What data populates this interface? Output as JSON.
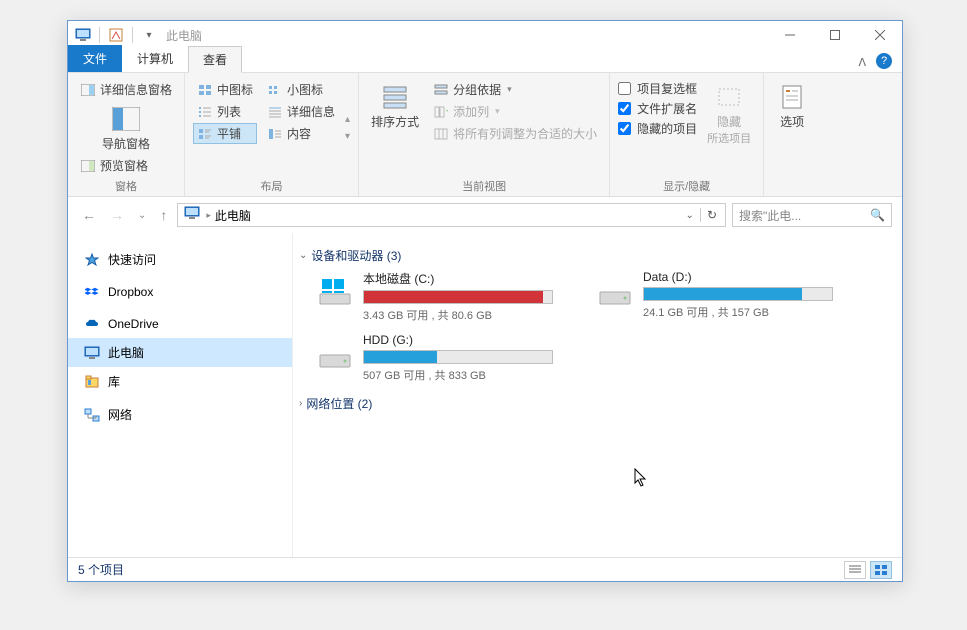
{
  "window": {
    "title": "此电脑"
  },
  "tabs": {
    "file": "文件",
    "computer": "计算机",
    "view": "查看"
  },
  "ribbon": {
    "panes": {
      "nav_pane": "导航窗格",
      "preview_pane": "预览窗格",
      "details_pane": "详细信息窗格",
      "group_label": "窗格"
    },
    "layout": {
      "medium_icons": "中图标",
      "small_icons": "小图标",
      "list": "列表",
      "details": "详细信息",
      "tiles": "平铺",
      "content": "内容",
      "group_label": "布局"
    },
    "current_view": {
      "sort_by": "排序方式",
      "group_by": "分组依据",
      "add_columns": "添加列",
      "size_all": "将所有列调整为合适的大小",
      "group_label": "当前视图"
    },
    "show_hide": {
      "item_check": "项目复选框",
      "file_ext": "文件扩展名",
      "hidden_items": "隐藏的项目",
      "hide": "隐藏",
      "hide_sub": "所选项目",
      "group_label": "显示/隐藏"
    },
    "options": {
      "label": "选项"
    }
  },
  "address": {
    "crumb": "此电脑"
  },
  "search": {
    "placeholder": "搜索\"此电..."
  },
  "sidebar": {
    "items": [
      {
        "label": "快速访问",
        "icon": "star"
      },
      {
        "label": "Dropbox",
        "icon": "dropbox"
      },
      {
        "label": "OneDrive",
        "icon": "onedrive"
      },
      {
        "label": "此电脑",
        "icon": "pc",
        "selected": true
      },
      {
        "label": "库",
        "icon": "libraries"
      },
      {
        "label": "网络",
        "icon": "network"
      }
    ]
  },
  "content": {
    "devices_header": "设备和驱动器 (3)",
    "drives": [
      {
        "name": "本地磁盘 (C:)",
        "text": "3.43 GB 可用 , 共 80.6 GB",
        "fill_pct": 95,
        "danger": true,
        "icon": "osdisk"
      },
      {
        "name": "Data (D:)",
        "text": "24.1 GB 可用 , 共 157 GB",
        "fill_pct": 84,
        "danger": false,
        "icon": "disk"
      },
      {
        "name": "HDD (G:)",
        "text": "507 GB 可用 , 共 833 GB",
        "fill_pct": 39,
        "danger": false,
        "icon": "disk"
      }
    ],
    "network_header": "网络位置 (2)"
  },
  "status": {
    "text": "5 个项目"
  }
}
